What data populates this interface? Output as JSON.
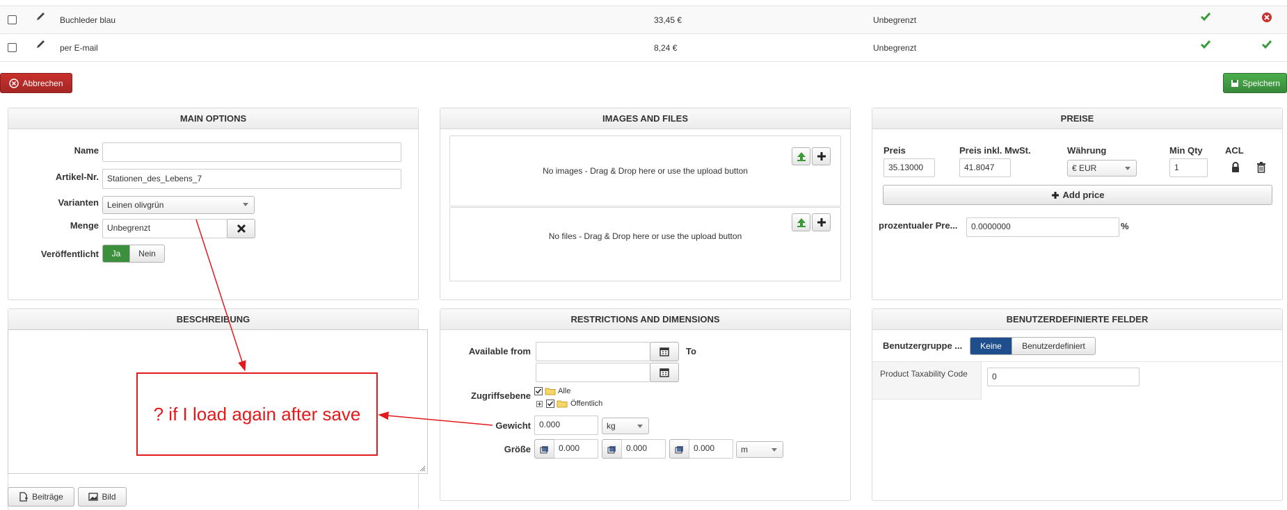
{
  "table": {
    "rows": [
      {
        "name": "Buchleder blau",
        "price": "33,45 €",
        "stock": "Unbegrenzt",
        "published": "check",
        "status": "remove"
      },
      {
        "name": "per E-mail",
        "price": "8,24 €",
        "stock": "Unbegrenzt",
        "published": "check",
        "status": "check"
      }
    ]
  },
  "toolbar": {
    "cancel_label": "Abbrechen",
    "save_label": "Speichern"
  },
  "main_options": {
    "title": "MAIN OPTIONS",
    "name_label": "Name",
    "name_value": "",
    "sku_label": "Artikel-Nr.",
    "sku_value": "Stationen_des_Lebens_7",
    "variant_label": "Varianten",
    "variant_value": "Leinen olivgrün",
    "qty_label": "Menge",
    "qty_value": "Unbegrenzt",
    "published_label": "Veröffentlicht",
    "yes": "Ja",
    "no": "Nein"
  },
  "images_files": {
    "title": "IMAGES AND FILES",
    "no_images": "No images - Drag & Drop here or use the upload button",
    "no_files": "No files - Drag & Drop here or use the upload button"
  },
  "prices": {
    "title": "PREISE",
    "col_price": "Preis",
    "col_price_gross": "Preis inkl. MwSt.",
    "col_currency": "Währung",
    "col_min_qty": "Min Qty",
    "col_acl": "ACL",
    "price": "35.13000",
    "price_gross": "41.8047",
    "currency": "€ EUR",
    "min_qty": "1",
    "add_price": "Add price",
    "percent_label": "prozentualer Pre...",
    "percent_value": "0.0000000",
    "percent_unit": "%"
  },
  "description": {
    "title": "BESCHREIBUNG",
    "articles_button": "Beiträge",
    "image_button": "Bild"
  },
  "restrictions": {
    "title": "RESTRICTIONS AND DIMENSIONS",
    "available_from": "Available from",
    "to": "To",
    "access_label": "Zugriffsebene",
    "access_all": "Alle",
    "access_public": "Öffentlich",
    "weight_label": "Gewicht",
    "weight_value": "0.000",
    "weight_unit": "kg",
    "size_label": "Größe",
    "size_l": "0.000",
    "size_w": "0.000",
    "size_h": "0.000",
    "size_unit": "m"
  },
  "custom_fields": {
    "title": "BENUTZERDEFINIERTE FELDER",
    "group_label": "Benutzergruppe ...",
    "none": "Keine",
    "custom": "Benutzerdefiniert",
    "tax_label": "Product Taxability Code",
    "tax_value": "0"
  },
  "annotation": {
    "text": "? if I load again after save",
    "color": "#e3191c"
  },
  "colors": {
    "check": "#3a9a3a",
    "remove": "#c9302c",
    "active_green": "#3c8f3c",
    "active_blue": "#1f4e8c"
  }
}
